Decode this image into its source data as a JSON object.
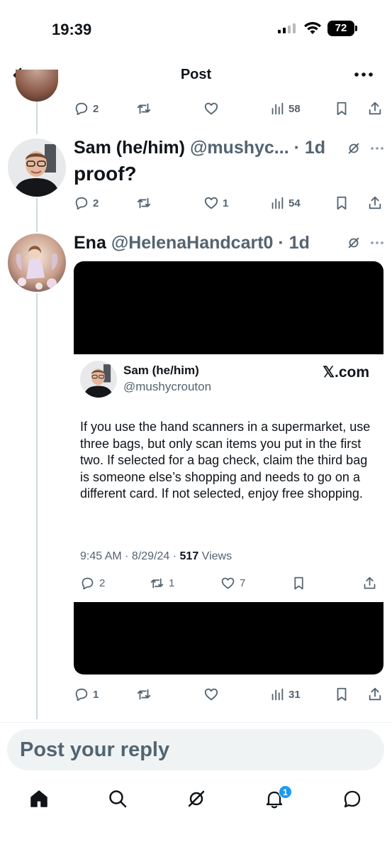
{
  "status_bar": {
    "time": "19:39",
    "battery": "72"
  },
  "header": {
    "title": "Post"
  },
  "post_top": {
    "metrics": {
      "replies": "2",
      "reposts": "",
      "likes": "",
      "views": "58"
    }
  },
  "reply_sam": {
    "display_name": "Sam (he/him)",
    "handle": "@mushyc...",
    "time": "· 1d",
    "text": "proof?",
    "metrics": {
      "replies": "2",
      "reposts": "",
      "likes": "1",
      "views": "54"
    }
  },
  "reply_ena": {
    "display_name": "Ena",
    "handle": "@HelenaHandcart0",
    "time": "· 1d",
    "embed": {
      "display_name": "Sam (he/him)",
      "handle": "@mushycrouton",
      "logo": "𝕏.com",
      "text": "If you use the hand scanners in a supermarket, use three bags, but only scan items you put in the first two. If selected for a bag check, claim the third bag is someone else’s shopping and needs to go on a different card. If not selected, enjoy free shopping.",
      "timestamp": "9:45 AM · 8/29/24 · ",
      "views_count": "517",
      "views_label": " Views",
      "metrics": {
        "replies": "2",
        "reposts": "1",
        "likes": "7"
      }
    },
    "metrics": {
      "replies": "1",
      "reposts": "",
      "likes": "",
      "views": "31"
    }
  },
  "reply_bar": {
    "placeholder": "Post your reply"
  },
  "tabbar": {
    "tabs": [
      "home-icon",
      "search-icon",
      "grok-icon",
      "notifications-icon",
      "messages-icon"
    ],
    "notification_badge": "1"
  },
  "colors": {
    "accent": "#1d9bf0",
    "text": "#0f1419",
    "secondary": "#536471",
    "divider": "#cfd9de"
  }
}
